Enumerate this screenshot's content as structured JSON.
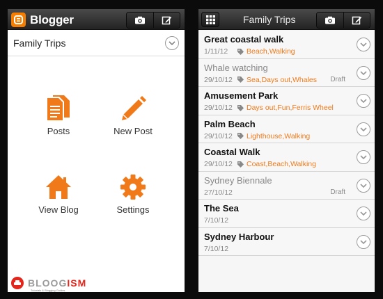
{
  "left_screen": {
    "app_name": "Blogger",
    "blog_name": "Family Trips",
    "tiles": [
      {
        "label": "Posts",
        "icon": "posts-document-icon"
      },
      {
        "label": "New Post",
        "icon": "pencil-icon"
      },
      {
        "label": "View Blog",
        "icon": "house-icon"
      },
      {
        "label": "Settings",
        "icon": "gear-icon"
      }
    ]
  },
  "right_screen": {
    "title": "Family Trips",
    "posts": [
      {
        "title": "Great coastal walk",
        "date": "1/11/12",
        "tags": "Beach,Walking",
        "status": ""
      },
      {
        "title": "Whale watching",
        "date": "29/10/12",
        "tags": "Sea,Days out,Whales",
        "status": "Draft"
      },
      {
        "title": "Amusement Park",
        "date": "29/10/12",
        "tags": "Days out,Fun,Ferris Wheel",
        "status": ""
      },
      {
        "title": "Palm Beach",
        "date": "29/10/12",
        "tags": "Lighthouse,Walking",
        "status": ""
      },
      {
        "title": "Coastal Walk",
        "date": "29/10/12",
        "tags": "Coast,Beach,Walking",
        "status": ""
      },
      {
        "title": "Sydney Biennale",
        "date": "27/10/12",
        "tags": "",
        "status": "Draft"
      },
      {
        "title": "The Sea",
        "date": "7/10/12",
        "tags": "",
        "status": ""
      },
      {
        "title": "Sydney Harbour",
        "date": "7/10/12",
        "tags": "",
        "status": ""
      }
    ]
  },
  "watermark": {
    "brand_a": "BLOOG",
    "brand_b": "ISM",
    "tagline": "Tutorials & Blogging Guides"
  },
  "colors": {
    "accent": "#f07a1a",
    "topbar": "#2c2c2c",
    "background": "#0b0b0b"
  }
}
